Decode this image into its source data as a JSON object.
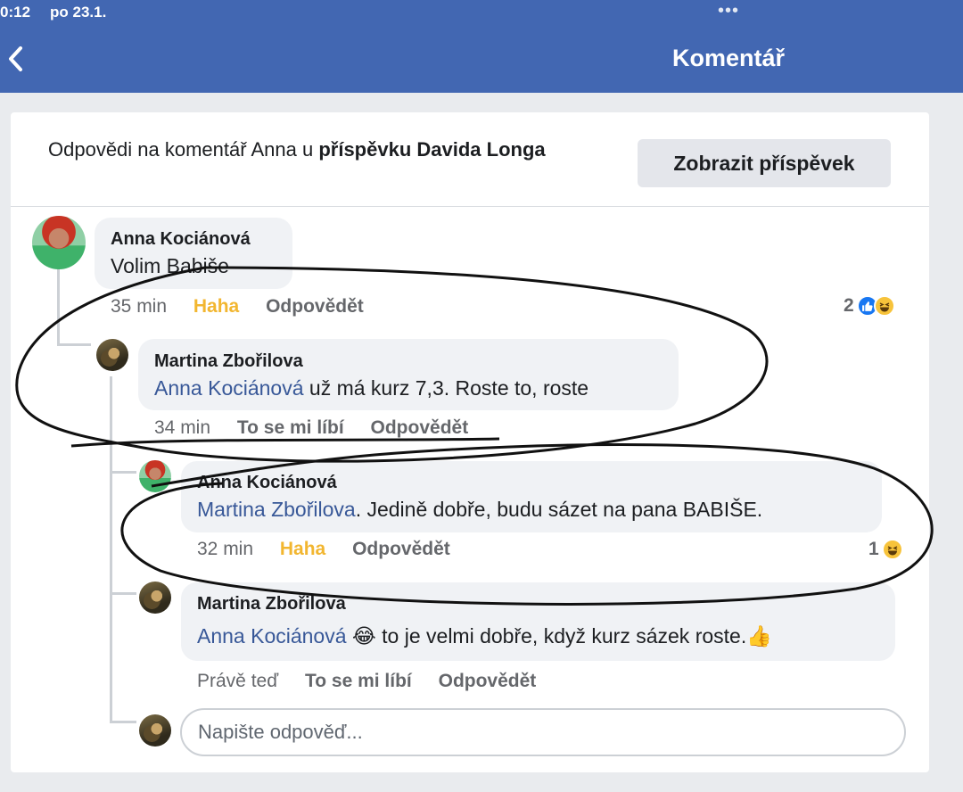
{
  "status_bar": {
    "time": "0:12",
    "date": "po 23.1.",
    "dots": "•••"
  },
  "header": {
    "title": "Komentář"
  },
  "thread_header": {
    "text_prefix": "Odpovědi na komentář Anna u ",
    "text_bold": "příspěvku Davida Longa",
    "show_post_label": "Zobrazit příspěvek"
  },
  "comments": [
    {
      "author": "Anna Kociánová",
      "text": "Volim Babiše",
      "time": "35 min",
      "action_reaction": "Haha",
      "action_reply": "Odpovědět",
      "reaction_count": "2"
    },
    {
      "author": "Martina Zbořilova",
      "mention": "Anna Kociánová",
      "text": " už má kurz 7,3. Roste to, roste",
      "time": "34 min",
      "action_reaction": "To se mi líbí",
      "action_reply": "Odpovědět"
    },
    {
      "author": "Anna Kociánová",
      "mention": "Martina Zbořilova",
      "text": ". Jedině dobře, budu sázet na pana BABIŠE.",
      "time": "32 min",
      "action_reaction": "Haha",
      "action_reply": "Odpovědět",
      "reaction_count": "1"
    },
    {
      "author": "Martina Zbořilova",
      "mention": "Anna Kociánová",
      "emoji": "😂",
      "text": " to je velmi dobře, když kurz sázek roste.",
      "emoji_end": "👍",
      "time": "Právě teď",
      "action_reaction": "To se mi líbí",
      "action_reply": "Odpovědět"
    }
  ],
  "reply_input": {
    "placeholder": "Napište odpověď..."
  },
  "icons": {
    "back": "chevron-left-icon",
    "like": "like-icon",
    "haha": "haha-icon"
  },
  "colors": {
    "header_bg": "#4267b2",
    "mention": "#385898",
    "haha": "#f2b630",
    "bubble_bg": "#f0f2f5"
  }
}
